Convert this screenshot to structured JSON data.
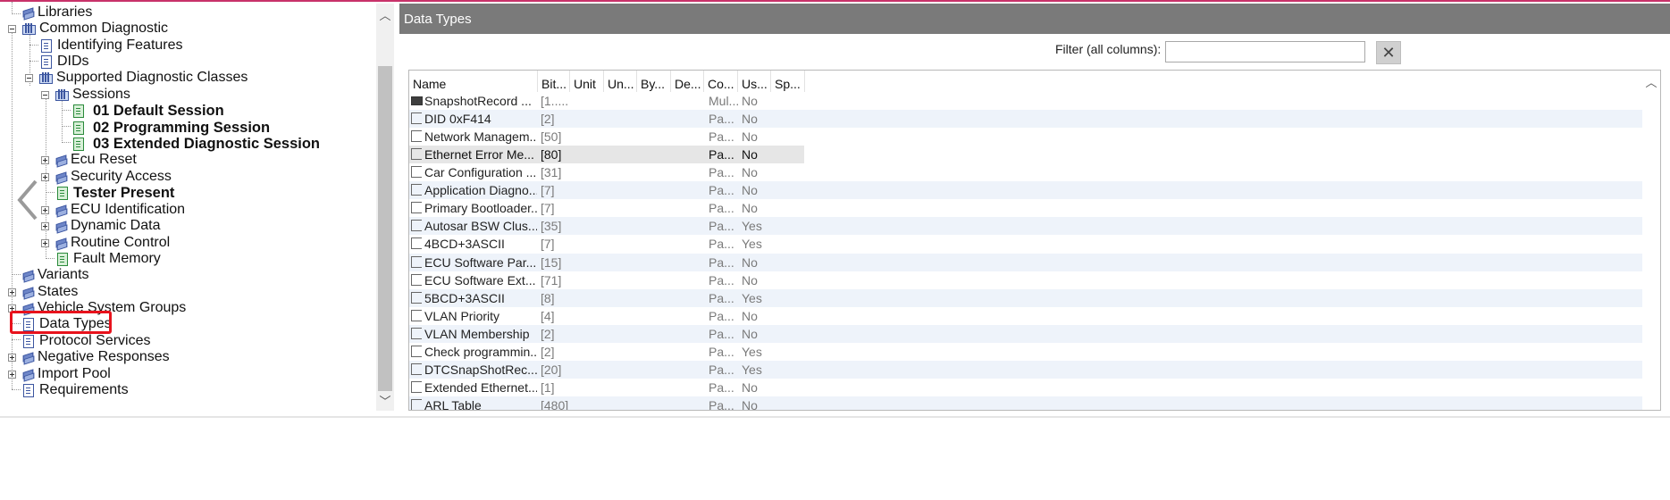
{
  "tree": {
    "items": [
      {
        "label": "Libraries",
        "icon": "stack-icon",
        "bold": false
      },
      {
        "label": "Common Diagnostic",
        "icon": "folder-icon",
        "bold": false
      },
      {
        "label": "Identifying Features",
        "icon": "document-icon",
        "bold": false
      },
      {
        "label": "DIDs",
        "icon": "document-icon",
        "bold": false
      },
      {
        "label": "Supported Diagnostic Classes",
        "icon": "folder-icon",
        "bold": false
      },
      {
        "label": "Sessions",
        "icon": "folder-icon",
        "bold": false
      },
      {
        "label": "01 Default Session",
        "icon": "green-document-icon",
        "bold": true
      },
      {
        "label": "02 Programming Session",
        "icon": "green-document-icon",
        "bold": true
      },
      {
        "label": "03 Extended Diagnostic Session",
        "icon": "green-document-icon",
        "bold": true
      },
      {
        "label": "Ecu Reset",
        "icon": "stack-icon",
        "bold": false
      },
      {
        "label": "Security Access",
        "icon": "stack-icon",
        "bold": false
      },
      {
        "label": "Tester Present",
        "icon": "green-document-icon",
        "bold": true
      },
      {
        "label": "ECU Identification",
        "icon": "stack-icon",
        "bold": false
      },
      {
        "label": "Dynamic Data",
        "icon": "stack-icon",
        "bold": false
      },
      {
        "label": "Routine Control",
        "icon": "stack-icon",
        "bold": false
      },
      {
        "label": "Fault Memory",
        "icon": "green-document-icon",
        "bold": false
      },
      {
        "label": "Variants",
        "icon": "stack-icon",
        "bold": false
      },
      {
        "label": "States",
        "icon": "stack-icon",
        "bold": false
      },
      {
        "label": "Vehicle System Groups",
        "icon": "stack-icon",
        "bold": false
      },
      {
        "label": "Data Types",
        "icon": "document-icon",
        "bold": false
      },
      {
        "label": "Protocol Services",
        "icon": "document-icon",
        "bold": false
      },
      {
        "label": "Negative Responses",
        "icon": "stack-icon",
        "bold": false
      },
      {
        "label": "Import Pool",
        "icon": "stack-icon",
        "bold": false
      },
      {
        "label": "Requirements",
        "icon": "document-icon",
        "bold": false
      }
    ]
  },
  "panel": {
    "title": "Data Types",
    "filter_label": "Filter (all columns):",
    "filter_value": "",
    "clear_icon": "✕"
  },
  "grid": {
    "columns": [
      "Name",
      "Bit...",
      "Unit",
      "Un...",
      "By...",
      "De...",
      "Co...",
      "Us...",
      "Sp..."
    ],
    "rows": [
      {
        "name": "SnapshotRecord ...",
        "bits": "[1.....",
        "co": "Mul...",
        "us": "No",
        "icon": "snapshot-icon"
      },
      {
        "name": "DID 0xF414",
        "bits": "[2]",
        "co": "Pa...",
        "us": "No",
        "icon": "bracket-icon"
      },
      {
        "name": "Network Managem...",
        "bits": "[50]",
        "co": "Pa...",
        "us": "No",
        "icon": "bracket-icon"
      },
      {
        "name": "Ethernet Error Me...",
        "bits": "[80]",
        "co": "Pa...",
        "us": "No",
        "icon": "bracket-icon",
        "selected": true
      },
      {
        "name": "Car Configuration ...",
        "bits": "[31]",
        "co": "Pa...",
        "us": "No",
        "icon": "bracket-icon"
      },
      {
        "name": "Application Diagno...",
        "bits": "[7]",
        "co": "Pa...",
        "us": "No",
        "icon": "bracket-icon"
      },
      {
        "name": "Primary Bootloader...",
        "bits": "[7]",
        "co": "Pa...",
        "us": "No",
        "icon": "bracket-icon"
      },
      {
        "name": "Autosar BSW Clus...",
        "bits": "[35]",
        "co": "Pa...",
        "us": "Yes",
        "icon": "bracket-icon"
      },
      {
        "name": "4BCD+3ASCII",
        "bits": "[7]",
        "co": "Pa...",
        "us": "Yes",
        "icon": "bracket-icon"
      },
      {
        "name": "ECU Software Par...",
        "bits": "[15]",
        "co": "Pa...",
        "us": "No",
        "icon": "bracket-icon"
      },
      {
        "name": "ECU Software Ext...",
        "bits": "[71]",
        "co": "Pa...",
        "us": "No",
        "icon": "bracket-icon"
      },
      {
        "name": "5BCD+3ASCII",
        "bits": "[8]",
        "co": "Pa...",
        "us": "Yes",
        "icon": "bracket-icon"
      },
      {
        "name": "VLAN Priority",
        "bits": "[4]",
        "co": "Pa...",
        "us": "No",
        "icon": "bracket-icon"
      },
      {
        "name": "VLAN Membership",
        "bits": "[2]",
        "co": "Pa...",
        "us": "No",
        "icon": "bracket-icon"
      },
      {
        "name": "Check programmin...",
        "bits": "[2]",
        "co": "Pa...",
        "us": "Yes",
        "icon": "bracket-icon"
      },
      {
        "name": "DTCSnapShotRec...",
        "bits": "[20]",
        "co": "Pa...",
        "us": "Yes",
        "icon": "bracket-icon"
      },
      {
        "name": "Extended Ethernet...",
        "bits": "[1]",
        "co": "Pa...",
        "us": "No",
        "icon": "bracket-icon"
      },
      {
        "name": "ARL Table",
        "bits": "[480]",
        "co": "Pa...",
        "us": "No",
        "icon": "bracket-icon"
      }
    ]
  },
  "colors": {
    "header_bar": "#7a7a7a",
    "highlight": "#e8121c",
    "alt_row": "#eef3fa",
    "top_accent": "#c8326a"
  }
}
